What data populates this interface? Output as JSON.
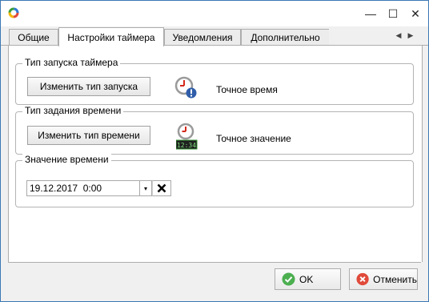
{
  "window": {
    "controls": {
      "close_glyph": "✕",
      "maximize_glyph": "☐",
      "minimize_glyph": "—"
    }
  },
  "tabs": [
    {
      "label": "Общие",
      "active": false
    },
    {
      "label": "Настройки таймера",
      "active": true
    },
    {
      "label": "Уведомления",
      "active": false
    },
    {
      "label": "Дополнительно",
      "active": false
    }
  ],
  "tab_nav": {
    "prev": "◀",
    "next": "▶"
  },
  "groups": {
    "start_type": {
      "title": "Тип запуска таймера",
      "button_label": "Изменить тип запуска",
      "value_label": "Точное время",
      "icon": "clock-warning-icon"
    },
    "time_type": {
      "title": "Тип задания времени",
      "button_label": "Изменить тип времени",
      "value_label": "Точное значение",
      "icon": "clock-digital-icon",
      "digital_readout": "12:34"
    },
    "time_value": {
      "title": "Значение времени",
      "datetime_value": "19.12.2017  0:00",
      "dropdown_glyph": "▾",
      "clear_icon": "x-icon"
    }
  },
  "footer": {
    "ok_label": "OK",
    "cancel_label": "Отменить"
  },
  "colors": {
    "accent": "#3c78b4",
    "ok_green": "#4caf50",
    "cancel_red": "#e04a3a",
    "clock_hand_red": "#d42a1c",
    "info_blue": "#2f5da8"
  }
}
